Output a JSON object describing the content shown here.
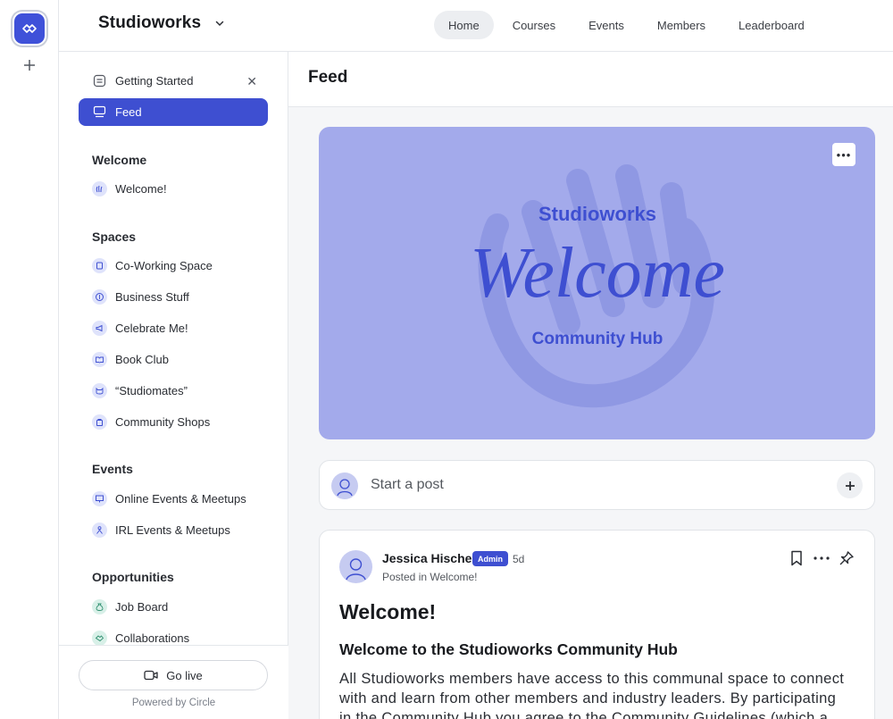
{
  "header": {
    "community_name": "Studioworks",
    "nav": [
      {
        "label": "Home"
      },
      {
        "label": "Courses"
      },
      {
        "label": "Events"
      },
      {
        "label": "Members"
      },
      {
        "label": "Leaderboard"
      }
    ],
    "active_nav": "Home"
  },
  "sidebar": {
    "getting_started": "Getting Started",
    "feed": "Feed",
    "welcome_heading": "Welcome",
    "welcome_item": "Welcome!",
    "spaces_heading": "Spaces",
    "spaces": [
      {
        "label": "Co-Working Space",
        "icon": "note-icon"
      },
      {
        "label": "Business Stuff",
        "icon": "dollar-icon"
      },
      {
        "label": "Celebrate Me!",
        "icon": "megaphone-icon"
      },
      {
        "label": "Book Club",
        "icon": "book-icon"
      },
      {
        "label": "“Studiomates”",
        "icon": "cat-icon"
      },
      {
        "label": "Community Shops",
        "icon": "bag-icon"
      }
    ],
    "events_heading": "Events",
    "events": [
      {
        "label": "Online Events & Meetups",
        "icon": "presentation-icon"
      },
      {
        "label": "IRL Events & Meetups",
        "icon": "people-icon"
      }
    ],
    "opportunities_heading": "Opportunities",
    "opportunities": [
      {
        "label": "Job Board",
        "icon": "money-bag-icon"
      },
      {
        "label": "Collaborations",
        "icon": "handshake-icon"
      }
    ],
    "go_live": "Go live",
    "powered_by": "Powered by Circle"
  },
  "main": {
    "feed_title": "Feed",
    "banner": {
      "brand": "Studioworks",
      "headline": "Welcome",
      "tagline": "Community Hub"
    },
    "composer": {
      "placeholder": "Start a post"
    },
    "post": {
      "author": "Jessica Hische",
      "badge": "Admin",
      "time": "5d",
      "posted_in_prefix": "Posted in ",
      "posted_in_space": "Welcome!",
      "title": "Welcome!",
      "subtitle": "Welcome to the Studioworks Community Hub",
      "body": "All Studioworks members have access to this communal space to connect with and learn from other members and industry leaders. By participating in the Community Hub you agree to the Community Guidelines (which a..."
    }
  },
  "colors": {
    "accent": "#3e4fd1",
    "banner_bg": "#a3aaeb",
    "banner_text": "#3e4fd1",
    "space_icon_bg": "#dfe3fb"
  }
}
